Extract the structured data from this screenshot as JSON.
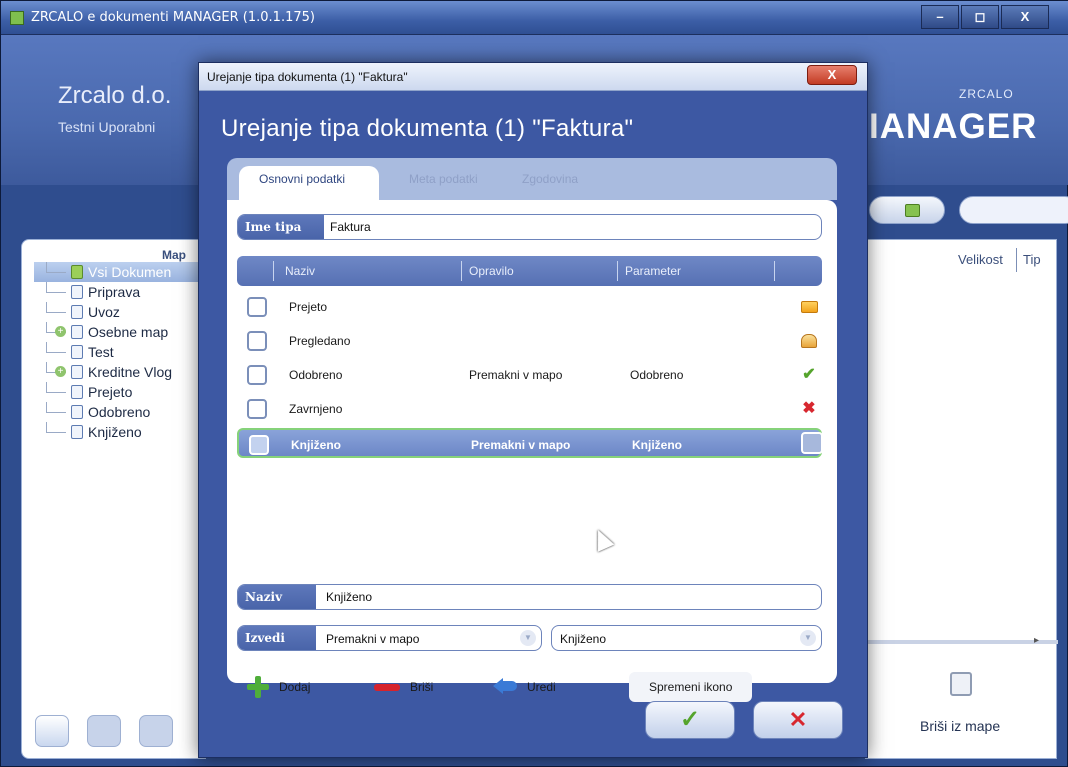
{
  "app": {
    "title": "ZRCALO e dokumenti MANAGER (1.0.1.175)",
    "window_buttons": {
      "minimize": "–",
      "restore": "◻",
      "close": "X"
    }
  },
  "header": {
    "company": "Zrcalo d.o.",
    "user": "Testni Uporabni",
    "brand_small": "ZRCALO",
    "brand_big": "IANAGER"
  },
  "left_panel": {
    "title": "Map",
    "tree": [
      {
        "label": "Vsi Dokumen",
        "selected": true,
        "expandable": false
      },
      {
        "label": "Priprava",
        "selected": false,
        "expandable": false
      },
      {
        "label": "Uvoz",
        "selected": false,
        "expandable": false
      },
      {
        "label": "Osebne map",
        "selected": false,
        "expandable": true
      },
      {
        "label": "Test",
        "selected": false,
        "expandable": false
      },
      {
        "label": "Kreditne Vlog",
        "selected": false,
        "expandable": true
      },
      {
        "label": "Prejeto",
        "selected": false,
        "expandable": false
      },
      {
        "label": "Odobreno",
        "selected": false,
        "expandable": false
      },
      {
        "label": "Knjiženo",
        "selected": false,
        "expandable": false
      }
    ]
  },
  "right_panel": {
    "col_velikost": "Velikost",
    "col_tip": "Tip",
    "remove_from_folder": "Briši iz mape"
  },
  "dialog": {
    "titlebar": "Urejanje tipa dokumenta (1) \"Faktura\"",
    "close_label": "X",
    "heading": "Urejanje tipa dokumenta (1) \"Faktura\"",
    "tabs": [
      "Osnovni podatki",
      "Meta podatki",
      "Zgodovina"
    ],
    "active_tab": 0,
    "type_name_label": "Ime tipa",
    "type_name_value": "Faktura",
    "grid": {
      "headers": [
        "Naziv",
        "Opravilo",
        "Parameter"
      ],
      "rows": [
        {
          "naziv": "Prejeto",
          "opravilo": "",
          "parameter": "",
          "icon": "envelope-icon"
        },
        {
          "naziv": "Pregledano",
          "opravilo": "",
          "parameter": "",
          "icon": "open-envelope-icon"
        },
        {
          "naziv": "Odobreno",
          "opravilo": "Premakni v mapo",
          "parameter": "Odobreno",
          "icon": "checkmark-icon"
        },
        {
          "naziv": "Zavrnjeno",
          "opravilo": "",
          "parameter": "",
          "icon": "x-icon"
        },
        {
          "naziv": "Knjiženo",
          "opravilo": "Premakni v mapo",
          "parameter": "Knjiženo",
          "icon": "blank-icon",
          "selected": true
        }
      ]
    },
    "naziv_label": "Naziv",
    "naziv_value": "Knjiženo",
    "izvedi_label": "Izvedi",
    "izvedi_value": "Premakni v mapo",
    "parameter_value": "Knjiženo",
    "actions": {
      "add": "Dodaj",
      "delete": "Briši",
      "edit": "Uredi",
      "change_icon": "Spremeni ikono"
    },
    "ok_label": "✓",
    "cancel_label": "✕"
  },
  "colors": {
    "dialog_bg": "#3d58a3",
    "selected_row_border": "#86d27a",
    "ok_green": "#55a42c",
    "cancel_red": "#d7272f"
  }
}
